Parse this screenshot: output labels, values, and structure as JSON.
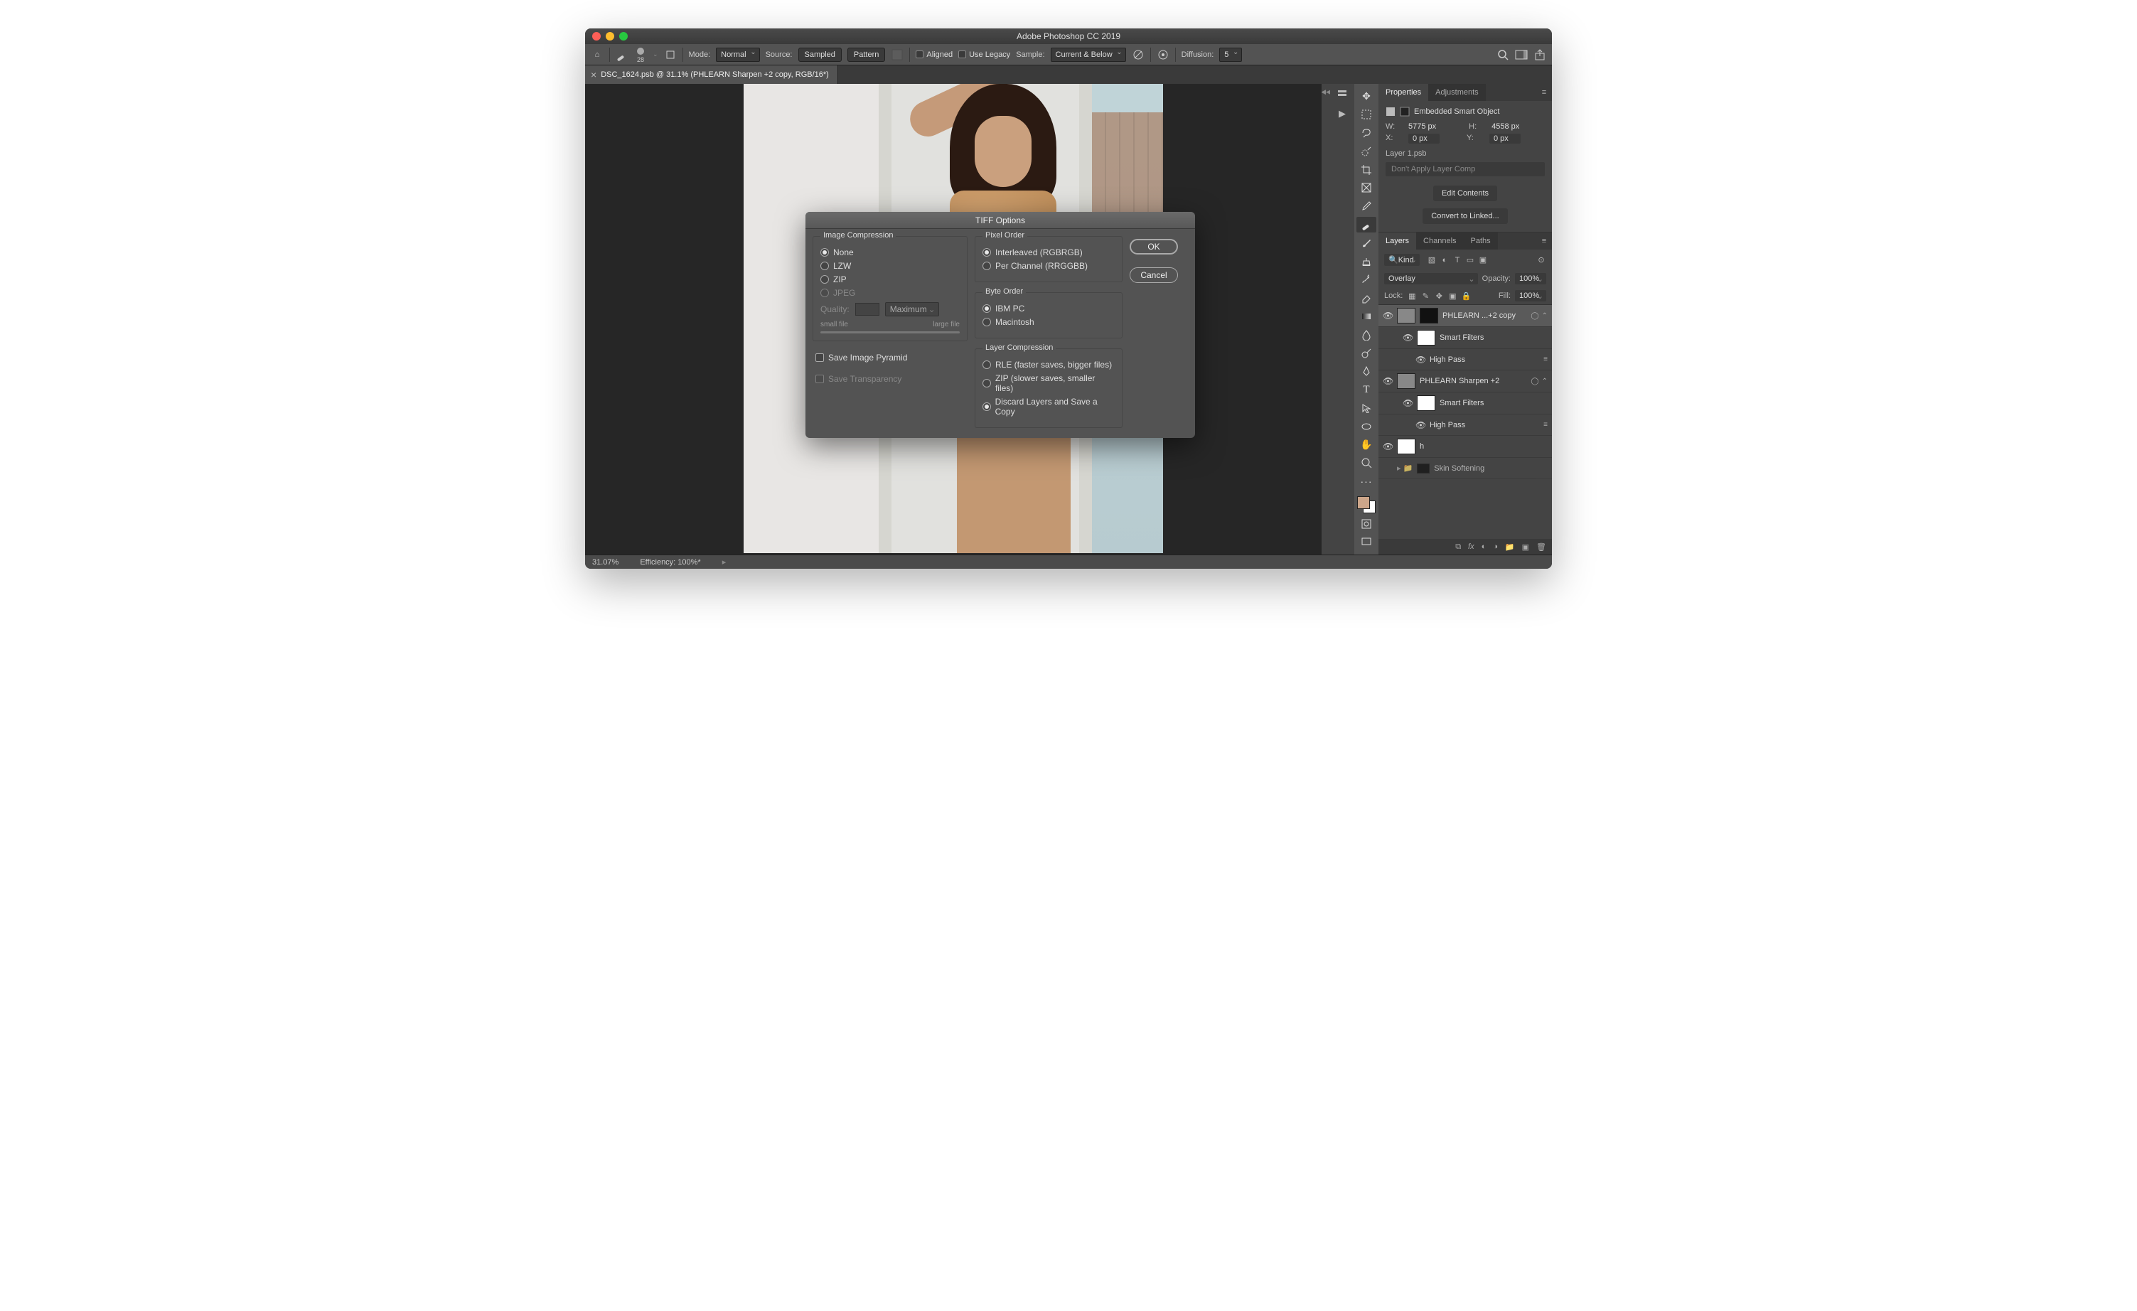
{
  "window": {
    "title": "Adobe Photoshop CC 2019"
  },
  "options_bar": {
    "brush_size": "28",
    "mode_label": "Mode:",
    "mode_value": "Normal",
    "source_label": "Source:",
    "source_sampled": "Sampled",
    "source_pattern": "Pattern",
    "aligned_label": "Aligned",
    "legacy_label": "Use Legacy",
    "sample_label": "Sample:",
    "sample_value": "Current & Below",
    "diffusion_label": "Diffusion:",
    "diffusion_value": "5"
  },
  "document_tab": {
    "close_glyph": "×",
    "title": "DSC_1624.psb @ 31.1% (PHLEARN Sharpen +2 copy, RGB/16*)"
  },
  "properties_panel": {
    "tab_properties": "Properties",
    "tab_adjustments": "Adjustments",
    "type_label": "Embedded Smart Object",
    "w_label": "W:",
    "w_value": "5775 px",
    "h_label": "H:",
    "h_value": "4558 px",
    "x_label": "X:",
    "x_value": "0 px",
    "y_label": "Y:",
    "y_value": "0 px",
    "filename": "Layer 1.psb",
    "layer_comp_dd": "Don't Apply Layer Comp",
    "btn_edit": "Edit Contents",
    "btn_convert": "Convert to Linked..."
  },
  "layers_panel": {
    "tab_layers": "Layers",
    "tab_channels": "Channels",
    "tab_paths": "Paths",
    "kind_dd": "Kind",
    "blend_dd": "Overlay",
    "opacity_label": "Opacity:",
    "opacity_value": "100%",
    "lock_label": "Lock:",
    "fill_label": "Fill:",
    "fill_value": "100%",
    "layers": [
      {
        "name": "PHLEARN ...+2 copy",
        "selected": true
      },
      {
        "name": "Smart Filters",
        "indent": 1
      },
      {
        "name": "High Pass",
        "indent": 2
      },
      {
        "name": "PHLEARN Sharpen +2"
      },
      {
        "name": "Smart Filters",
        "indent": 1
      },
      {
        "name": "High Pass",
        "indent": 2
      },
      {
        "name": "h"
      },
      {
        "name": "Skin Softening"
      }
    ],
    "footer_icons": [
      "∞",
      "fx",
      "◐",
      "◼",
      "▣",
      "🗑"
    ]
  },
  "statusbar": {
    "zoom": "31.07%",
    "efficiency": "Efficiency: 100%*"
  },
  "dialog": {
    "title": "TIFF Options",
    "ok": "OK",
    "cancel": "Cancel",
    "image_compression": {
      "legend": "Image Compression",
      "none": "None",
      "lzw": "LZW",
      "zip": "ZIP",
      "jpeg": "JPEG",
      "quality_label": "Quality:",
      "quality_dd": "Maximum",
      "small": "small file",
      "large": "large file",
      "selected": "none"
    },
    "save_pyramid": "Save Image Pyramid",
    "save_transparency": "Save Transparency",
    "pixel_order": {
      "legend": "Pixel Order",
      "interleaved": "Interleaved (RGBRGB)",
      "per_channel": "Per Channel (RRGGBB)",
      "selected": "interleaved"
    },
    "byte_order": {
      "legend": "Byte Order",
      "ibm": "IBM PC",
      "mac": "Macintosh",
      "selected": "ibm"
    },
    "layer_compression": {
      "legend": "Layer Compression",
      "rle": "RLE (faster saves, bigger files)",
      "zip": "ZIP (slower saves, smaller files)",
      "discard": "Discard Layers and Save a Copy",
      "selected": "discard"
    }
  }
}
